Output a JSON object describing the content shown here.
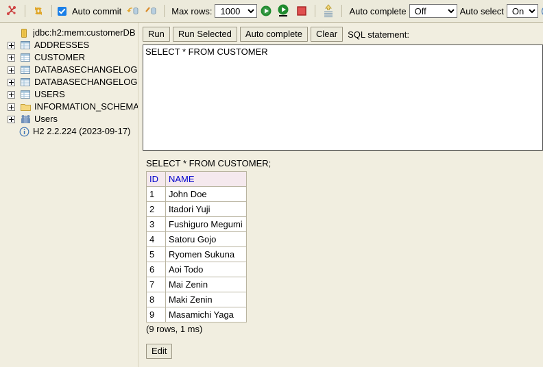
{
  "toolbar": {
    "disconnect_icon": "disconnect-icon",
    "refresh_icon": "refresh-icon",
    "auto_commit_label": "Auto commit",
    "rollback_icon": "rollback-icon",
    "commit_icon": "commit-icon",
    "max_rows_label": "Max rows:",
    "max_rows_value": "1000",
    "max_rows_options": [
      "1000"
    ],
    "run_icon": "run-icon",
    "run_selected_icon": "run-selected-icon",
    "stop_icon": "stop-icon",
    "history_icon": "history-icon",
    "auto_complete_label": "Auto complete",
    "auto_complete_value": "Off",
    "auto_complete_options": [
      "Off"
    ],
    "auto_select_label": "Auto select",
    "auto_select_value": "On",
    "auto_select_options": [
      "On"
    ],
    "help_icon": "help-icon"
  },
  "sidebar": {
    "items": [
      {
        "label": "jdbc:h2:mem:customerDB",
        "icon": "database-icon",
        "expandable": false
      },
      {
        "label": "ADDRESSES",
        "icon": "table-icon",
        "expandable": true
      },
      {
        "label": "CUSTOMER",
        "icon": "table-icon",
        "expandable": true
      },
      {
        "label": "DATABASECHANGELOG",
        "icon": "table-icon",
        "expandable": true
      },
      {
        "label": "DATABASECHANGELOGLO(",
        "icon": "table-icon",
        "expandable": true
      },
      {
        "label": "USERS",
        "icon": "table-icon",
        "expandable": true
      },
      {
        "label": "INFORMATION_SCHEMA",
        "icon": "folder-icon",
        "expandable": true
      },
      {
        "label": "Users",
        "icon": "users-icon",
        "expandable": true
      },
      {
        "label": "H2 2.2.224 (2023-09-17)",
        "icon": "info-icon",
        "expandable": false
      }
    ]
  },
  "editor": {
    "run_label": "Run",
    "run_selected_label": "Run Selected",
    "auto_complete_label": "Auto complete",
    "clear_label": "Clear",
    "sql_statement_label": "SQL statement:",
    "sql_value": "SELECT * FROM CUSTOMER"
  },
  "result": {
    "query": "SELECT * FROM CUSTOMER;",
    "columns": [
      "ID",
      "NAME"
    ],
    "rows": [
      [
        "1",
        "John Doe"
      ],
      [
        "2",
        "Itadori Yuji"
      ],
      [
        "3",
        "Fushiguro Megumi"
      ],
      [
        "4",
        "Satoru Gojo"
      ],
      [
        "5",
        "Ryomen Sukuna"
      ],
      [
        "6",
        "Aoi Todo"
      ],
      [
        "7",
        "Mai Zenin"
      ],
      [
        "8",
        "Maki Zenin"
      ],
      [
        "9",
        "Masamichi Yaga"
      ]
    ],
    "status": "(9 rows, 1 ms)",
    "edit_label": "Edit"
  }
}
